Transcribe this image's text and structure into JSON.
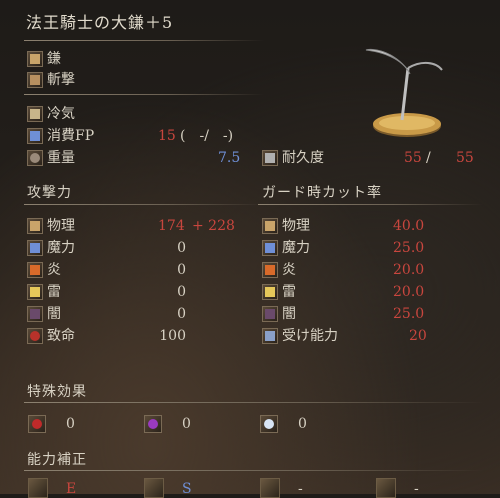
{
  "weapon": {
    "name": "法王騎士の大鎌＋5",
    "type": "鎌",
    "attack_type": "斬撃",
    "skill": "冷気",
    "fp_label": "消費FP",
    "fp_value": "15",
    "fp_extra": "(　-/　-)",
    "weight_label": "重量",
    "weight_value": "7.5",
    "durability_label": "耐久度",
    "durability_value": "55",
    "durability_slash": "/",
    "durability_max": "55"
  },
  "attack": {
    "heading": "攻撃力",
    "rows": [
      {
        "label": "物理",
        "value": "174",
        "bonus": "+  228"
      },
      {
        "label": "魔力",
        "value": "0"
      },
      {
        "label": "炎",
        "value": "0"
      },
      {
        "label": "雷",
        "value": "0"
      },
      {
        "label": "闇",
        "value": "0"
      },
      {
        "label": "致命",
        "value": "100"
      }
    ]
  },
  "guard": {
    "heading": "ガード時カット率",
    "rows": [
      {
        "label": "物理",
        "value": "40.0"
      },
      {
        "label": "魔力",
        "value": "25.0"
      },
      {
        "label": "炎",
        "value": "20.0"
      },
      {
        "label": "雷",
        "value": "20.0"
      },
      {
        "label": "闇",
        "value": "25.0"
      },
      {
        "label": "受け能力",
        "value": "20"
      }
    ]
  },
  "special": {
    "heading": "特殊効果",
    "effects": [
      {
        "icon": "bleed-icon",
        "value": "0"
      },
      {
        "icon": "poison-icon",
        "value": "0"
      },
      {
        "icon": "frost-icon",
        "value": "0"
      }
    ]
  },
  "scaling": {
    "heading": "能力補正",
    "items": [
      {
        "icon": "strength-icon",
        "grade": "E"
      },
      {
        "icon": "dexterity-icon",
        "grade": "S"
      },
      {
        "icon": "intelligence-icon",
        "grade": "-"
      },
      {
        "icon": "faith-icon",
        "grade": "-"
      }
    ]
  },
  "colors": {
    "red": "#c8463e",
    "blue": "#6f8fd6",
    "text": "#d8d2c4"
  }
}
